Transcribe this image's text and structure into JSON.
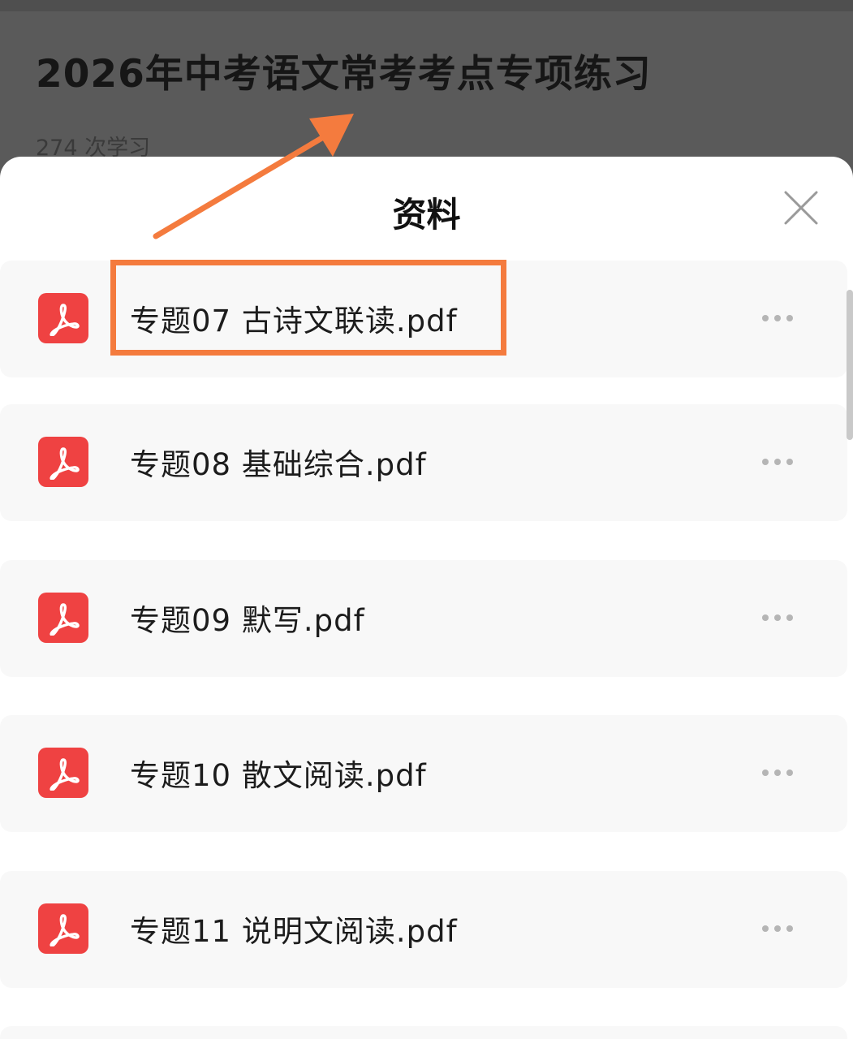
{
  "background_page": {
    "title": "2026年中考语文常考考点专项练习",
    "study_count": "274 次学习"
  },
  "sheet": {
    "title": "资料",
    "close_icon": "close-icon",
    "files": [
      {
        "name": "专题07 古诗文联读.pdf",
        "icon": "pdf-icon",
        "highlighted": true
      },
      {
        "name": "专题08 基础综合.pdf",
        "icon": "pdf-icon"
      },
      {
        "name": "专题09 默写.pdf",
        "icon": "pdf-icon"
      },
      {
        "name": "专题10 散文阅读.pdf",
        "icon": "pdf-icon"
      },
      {
        "name": "专题11 说明文阅读.pdf",
        "icon": "pdf-icon"
      }
    ]
  },
  "colors": {
    "pdf_icon": "#ef4242",
    "annotation": "#f47b3e",
    "overlay": "#585858"
  }
}
